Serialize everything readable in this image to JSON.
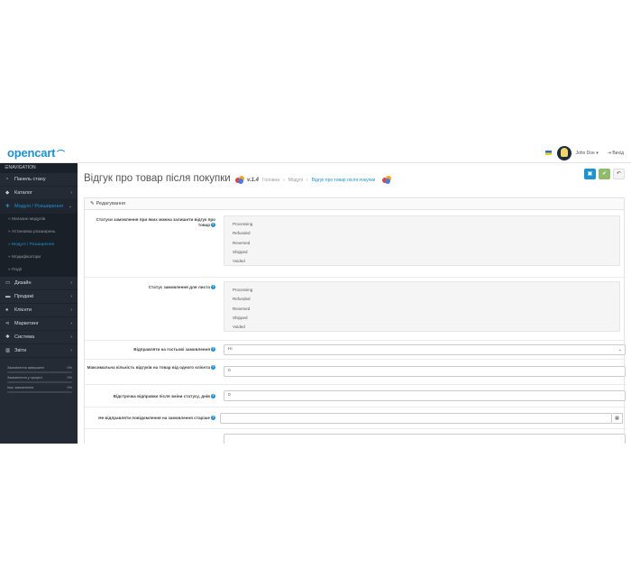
{
  "header": {
    "logo": "opencart",
    "logo_mark": "..",
    "user_name": "John Doe",
    "logout_label": "Вихід"
  },
  "sidebar": {
    "nav_title": "NAVIGATION",
    "items": [
      {
        "label": "Панель стану",
        "icon": "dashboard-icon",
        "arrow": ""
      },
      {
        "label": "Каталог",
        "icon": "tag-icon",
        "arrow": "›"
      },
      {
        "label": "Модулі / Розширення",
        "icon": "puzzle-icon",
        "arrow": "⌄",
        "active": true
      },
      {
        "label": "Дизайн",
        "icon": "monitor-icon",
        "arrow": "›"
      },
      {
        "label": "Продажі",
        "icon": "cart-icon",
        "arrow": "›"
      },
      {
        "label": "Клієнти",
        "icon": "user-icon",
        "arrow": "›"
      },
      {
        "label": "Маркетинг",
        "icon": "share-icon",
        "arrow": "›"
      },
      {
        "label": "Система",
        "icon": "gear-icon",
        "arrow": "›"
      },
      {
        "label": "Звіти",
        "icon": "chart-icon",
        "arrow": "›"
      }
    ],
    "subitems": [
      {
        "label": "Магазин модулів"
      },
      {
        "label": "Установка розширень"
      },
      {
        "label": "Модулі / Розширення",
        "active": true
      },
      {
        "label": "Модифікатори"
      },
      {
        "label": "Події"
      }
    ],
    "stats": [
      {
        "label": "Замовлення завершені",
        "pct": "0%"
      },
      {
        "label": "Замовлення у процесі",
        "pct": "0%"
      },
      {
        "label": "Інші замовлення",
        "pct": "0%"
      }
    ]
  },
  "main": {
    "title": "Відгук про товар після покупки",
    "version": "v.1.4",
    "breadcrumb": [
      "Головна",
      "Модулі",
      "Відгук про товар після покупки"
    ],
    "panel_title": "Редагування",
    "rows": {
      "statuses_label": "Статуси замовлення при яких можна залишити відгук про товар",
      "letter_status_label": "Статус замовлення для листа",
      "guest_label": "Відправляти на гостьові замовлення",
      "guest_value": "Ні",
      "max_reviews_label": "Максимальна кількість відгуків на товар від одного клієнта",
      "max_reviews_value": "0",
      "delay_label": "Відстрочка відправки після зміни статусу, днів",
      "delay_value": "0",
      "older_label": "Не відправляти повідомлення на замовлення старіше",
      "older_value": ""
    },
    "status_options": [
      "Processing",
      "Refunded",
      "Reversed",
      "Shipped",
      "Voided"
    ]
  },
  "colors": {
    "accent": "#1e91cf",
    "sidebar_bg": "#242b34",
    "save_green": "#8fbb6c"
  }
}
